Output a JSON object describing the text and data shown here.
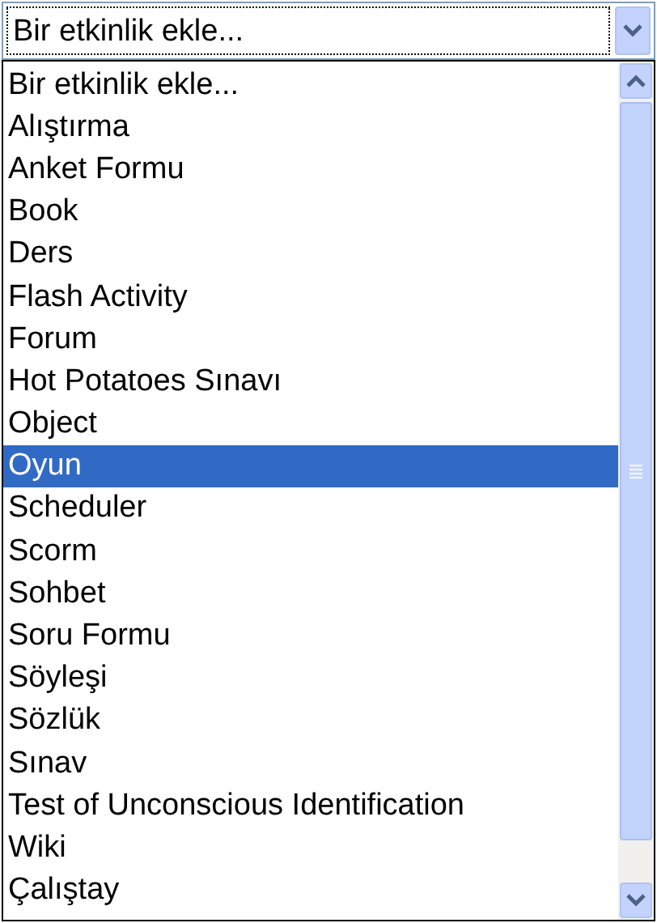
{
  "select": {
    "value": "Bir etkinlik ekle..."
  },
  "options": [
    {
      "label": "Bir etkinlik ekle...",
      "selected": false
    },
    {
      "label": "Alıştırma",
      "selected": false
    },
    {
      "label": "Anket Formu",
      "selected": false
    },
    {
      "label": "Book",
      "selected": false
    },
    {
      "label": "Ders",
      "selected": false
    },
    {
      "label": "Flash Activity",
      "selected": false
    },
    {
      "label": "Forum",
      "selected": false
    },
    {
      "label": "Hot Potatoes Sınavı",
      "selected": false
    },
    {
      "label": "Object",
      "selected": false
    },
    {
      "label": "Oyun",
      "selected": true
    },
    {
      "label": "Scheduler",
      "selected": false
    },
    {
      "label": "Scorm",
      "selected": false
    },
    {
      "label": "Sohbet",
      "selected": false
    },
    {
      "label": "Soru Formu",
      "selected": false
    },
    {
      "label": "Söyleşi",
      "selected": false
    },
    {
      "label": "Sözlük",
      "selected": false
    },
    {
      "label": "Sınav",
      "selected": false
    },
    {
      "label": "Test of Unconscious Identification",
      "selected": false
    },
    {
      "label": "Wiki",
      "selected": false
    },
    {
      "label": "Çalıştay",
      "selected": false
    }
  ]
}
